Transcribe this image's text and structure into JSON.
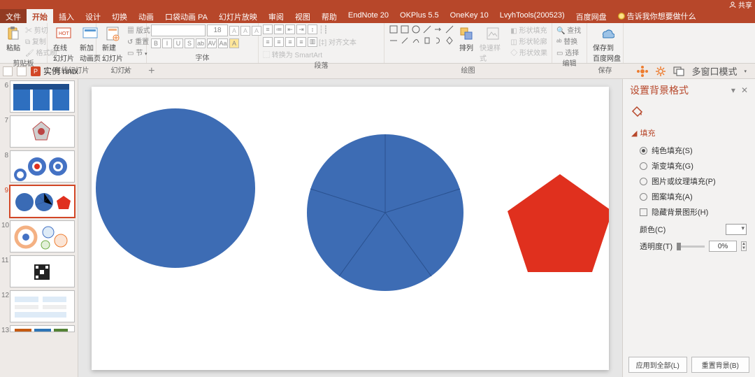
{
  "titlebar": {
    "share": "共享"
  },
  "tabs": {
    "file": "文件",
    "home": "开始",
    "insert": "插入",
    "design": "设计",
    "transitions": "切换",
    "animations": "动画",
    "pocketPA": "口袋动画 PA",
    "slideshow": "幻灯片放映",
    "review": "审阅",
    "view": "视图",
    "help": "帮助",
    "endnote": "EndNote 20",
    "okplus": "OKPlus 5.5",
    "onekey": "OneKey 10",
    "lvyh": "LvyhTools(200523)",
    "baidu": "百度网盘",
    "tellme": "告诉我你想要做什么"
  },
  "ribbon": {
    "clipboard": {
      "label": "剪贴板",
      "paste": "粘贴",
      "cut": "剪切",
      "copy": "复制",
      "formatPainter": "格式刷"
    },
    "online": {
      "label": "在线幻灯片",
      "online": "在线\n幻灯片",
      "newfrom": "新加\n动画页"
    },
    "slides": {
      "label": "幻灯片",
      "new": "新建\n幻灯片",
      "layout": "版式",
      "reset": "重置",
      "section": "节"
    },
    "font": {
      "label": "字体",
      "size": "18"
    },
    "paragraph": {
      "label": "段落",
      "align": "对齐文本",
      "smart": "转换为 SmartArt"
    },
    "drawing": {
      "label": "绘图",
      "arrange": "排列",
      "quick": "快速样式",
      "fill": "形状填充",
      "outline": "形状轮廓",
      "effects": "形状效果"
    },
    "editing": {
      "label": "编辑",
      "find": "查找",
      "replace": "替换",
      "select": "选择"
    },
    "save": {
      "label": "保存",
      "btn": "保存到\n百度网盘"
    }
  },
  "docbar": {
    "filename": "实例  nntx",
    "multiWindow": "多窗口模式"
  },
  "thumbs": {
    "n6": "6",
    "n7": "7",
    "n8": "8",
    "n9": "9",
    "n10": "10",
    "n11": "11",
    "n12": "12",
    "n13": "13"
  },
  "panel": {
    "title": "设置背景格式",
    "section": "填充",
    "solid": "纯色填充(S)",
    "gradient": "渐变填充(G)",
    "picture": "图片或纹理填充(P)",
    "pattern": "图案填充(A)",
    "hide": "隐藏背景图形(H)",
    "color": "颜色(C)",
    "trans": "透明度(T)",
    "pct": "0%",
    "applyAll": "应用到全部(L)",
    "reset": "重置背景(B)"
  }
}
